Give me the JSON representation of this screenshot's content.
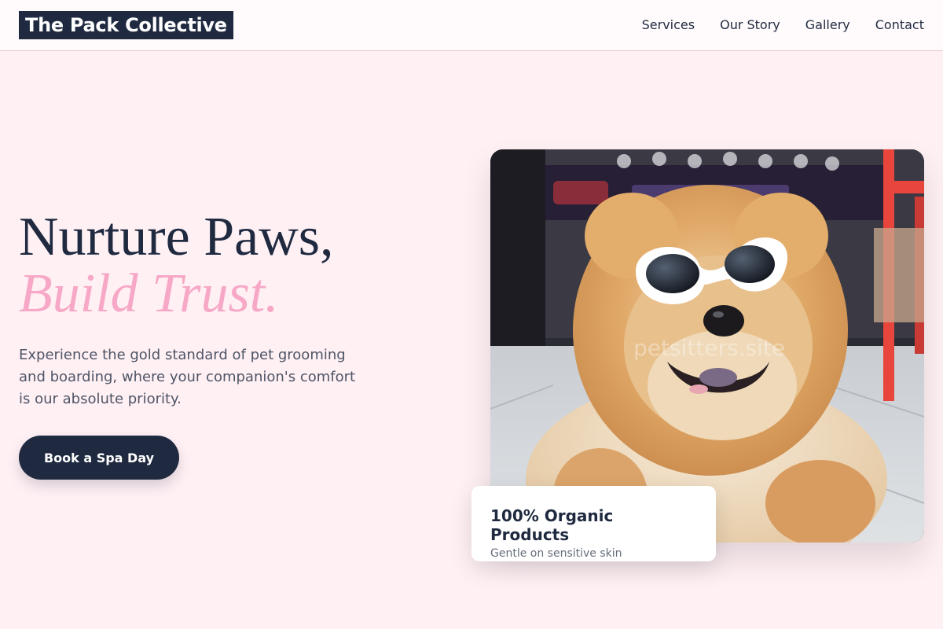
{
  "brand": {
    "name": "The Pack Collective"
  },
  "nav": {
    "links": [
      "Services",
      "Our Story",
      "Gallery",
      "Contact"
    ]
  },
  "hero": {
    "title_line1": "Nurture Paws,",
    "title_line2": "Build Trust.",
    "description": "Experience the gold standard of pet grooming and boarding, where your companion's comfort is our absolute priority.",
    "cta_label": "Book a Spa Day"
  },
  "photo": {
    "watermark": "petsitters.site"
  },
  "badge": {
    "title": "100% Organic Products",
    "subtitle": "Gentle on sensitive skin"
  },
  "colors": {
    "background": "#fff0f4",
    "navy": "#1f2a40",
    "accent_pink": "#f7a8c6"
  }
}
